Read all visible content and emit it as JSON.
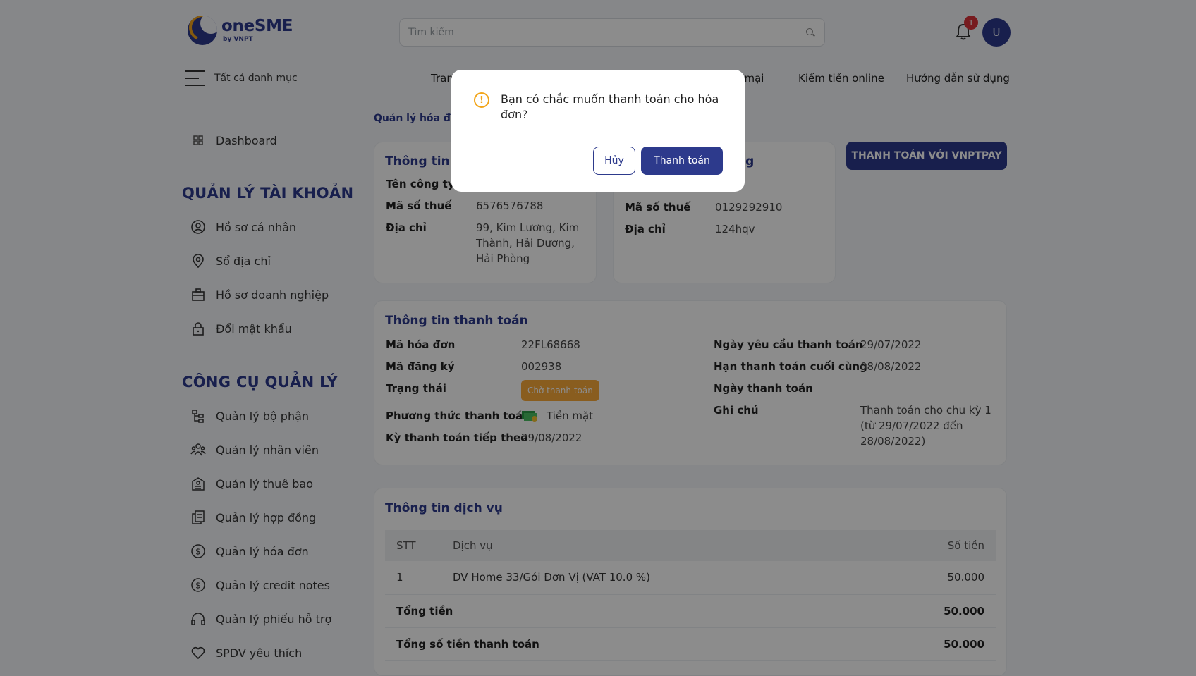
{
  "header": {
    "logo_name": "oneSME",
    "logo_sub": "by VNPT",
    "search_placeholder": "Tìm kiếm",
    "notification_count": "1",
    "avatar_initial": "U"
  },
  "nav": {
    "all_categories": "Tất cả danh mục",
    "items": [
      "Tran",
      "ến mại",
      "Kiếm tiền online",
      "Hướng dẫn sử dụng"
    ]
  },
  "sidebar": {
    "dashboard": "Dashboard",
    "account_heading": "QUẢN LÝ TÀI KHOẢN",
    "account_items": [
      "Hồ sơ cá nhân",
      "Sổ địa chỉ",
      "Hồ sơ doanh nghiệp",
      "Đổi mật khẩu"
    ],
    "tools_heading": "CÔNG CỤ QUẢN LÝ",
    "tools_items": [
      "Quản lý bộ phận",
      "Quản lý nhân viên",
      "Quản lý thuê bao",
      "Quản lý hợp đồng",
      "Quản lý hóa đơn",
      "Quản lý credit notes",
      "Quản lý phiếu hỗ trợ",
      "SPDV yêu thích"
    ]
  },
  "main": {
    "breadcrumb": "Quản lý hóa đơ",
    "vnptpay_button": "THANH TOÁN VỚI VNPTPAY",
    "buyer_card": {
      "title": "Thông tin n",
      "company_label": "Tên công ty",
      "tax_label": "Mã số thuế",
      "tax_value": "6576576788",
      "address_label": "Địa chỉ",
      "address_value": "99, Kim Lương, Kim Thành, Hải Dương, Hải Phòng"
    },
    "seller_card": {
      "title": "ng",
      "tax_label": "Mã số thuế",
      "tax_value": "0129292910",
      "address_label": "Địa chỉ",
      "address_value": "124hqv"
    },
    "payment": {
      "title": "Thông tin thanh toán",
      "invoice_code_label": "Mã hóa đơn",
      "invoice_code": "22FL68668",
      "register_code_label": "Mã đăng ký",
      "register_code": "002938",
      "status_label": "Trạng thái",
      "status": "Chờ thanh toán",
      "method_label": "Phương thức thanh toán",
      "method": "Tiền mặt",
      "next_period_label": "Kỳ thanh toán tiếp theo",
      "next_period": "29/08/2022",
      "request_date_label": "Ngày yêu cầu thanh toán",
      "request_date": "29/07/2022",
      "deadline_label": "Hạn thanh toán cuối cùng",
      "deadline": "08/08/2022",
      "paid_date_label": "Ngày thanh toán",
      "note_label": "Ghi chú",
      "note": "Thanh toán cho chu kỳ 1 (từ 29/07/2022 đến 28/08/2022)"
    },
    "service": {
      "title": "Thông tin dịch vụ",
      "col_stt": "STT",
      "col_service": "Dịch vụ",
      "col_amount": "Số tiền",
      "rows": [
        {
          "stt": "1",
          "service": "DV Home 33/Gói Đơn Vị (VAT 10.0 %)",
          "amount": "50.000"
        }
      ],
      "total_label": "Tổng tiền",
      "total": "50.000",
      "grand_total_label": "Tổng số tiền thanh toán",
      "grand_total": "50.000"
    }
  },
  "modal": {
    "message": "Bạn có chắc muốn thanh toán cho hóa đơn?",
    "cancel": "Hủy",
    "confirm": "Thanh toán"
  }
}
